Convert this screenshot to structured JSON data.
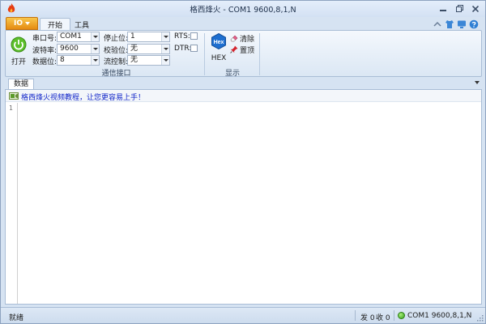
{
  "window": {
    "title": "格西烽火 - COM1  9600,8,1,N"
  },
  "app_menu": {
    "label": "IO"
  },
  "tabs": [
    {
      "label": "开始",
      "active": true
    },
    {
      "label": "工具",
      "active": false
    }
  ],
  "ribbon": {
    "open_label": "打开",
    "serial_group": {
      "title": "通信接口",
      "port_label": "串口号:",
      "port_value": "COM1",
      "baud_label": "波特率:",
      "baud_value": "9600",
      "databits_label": "数据位:",
      "databits_value": "8",
      "stopbits_label": "停止位:",
      "stopbits_value": "1",
      "parity_label": "校验位:",
      "parity_value": "无",
      "flow_label": "流控制:",
      "flow_value": "无",
      "rts_label": "RTS:",
      "dtr_label": "DTR:",
      "rts_checked": false,
      "dtr_checked": false
    },
    "display_group": {
      "title": "显示",
      "hex_label": "HEX",
      "hex_icon_text": "Hex",
      "clear_label": "清除",
      "pin_label": "置顶"
    }
  },
  "panel": {
    "tab_label": "数据",
    "ad_link": "格西烽火视频教程，让您更容易上手！",
    "line_number": "1"
  },
  "status": {
    "ready": "就绪",
    "sent": "发 0",
    "received": "收 0",
    "connection": "COM1  9600,8,1,N"
  },
  "icons": {
    "app": "flame-icon",
    "minimize": "minimize-icon",
    "restore": "restore-icon",
    "close": "close-icon",
    "power": "power-icon",
    "clear": "eraser-icon",
    "pin": "pin-icon"
  },
  "colors": {
    "accent_orange": "#f0a030",
    "link_blue": "#1226c9",
    "status_green": "#36a11a",
    "hex_blue": "#1e6fd0"
  }
}
